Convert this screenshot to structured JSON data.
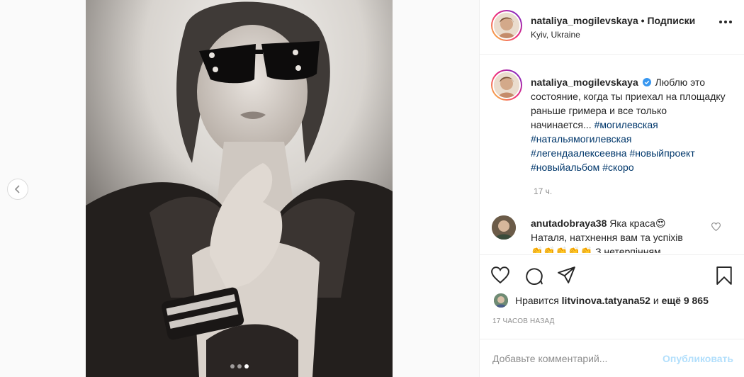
{
  "post": {
    "username": "nataliya_mogilevskaya",
    "separator": "•",
    "follow_label": "Подписки",
    "location": "Kyiv, Ukraine"
  },
  "caption": {
    "username": "nataliya_mogilevskaya",
    "text": "Люблю это состояние, когда ты приехал на площадку раньше гримера и все только начинается...",
    "hashtags": [
      "#могилевская",
      "#натальямогилевская",
      "#легендаалексеевна",
      "#новыйпроект",
      "#новыйальбом",
      "#скоро"
    ],
    "time": "17 ч."
  },
  "comment": {
    "username": "anutadobraya38",
    "text": "Яка краса",
    "emoji": "😍",
    "text2": "Наталя, натхнення вам та успіхів",
    "text3_emoji": "👏👏👏👏👏",
    "text3": "З нетерпінням"
  },
  "likes": {
    "prefix": "Нравится",
    "user": "litvinova.tatyana52",
    "and": "и",
    "count": "ещё 9 865"
  },
  "posted_ago": "17 ЧАСОВ НАЗАД",
  "add_comment": {
    "placeholder": "Добавьте комментарий...",
    "publish": "Опубликовать"
  },
  "carousel": {
    "slides": 3,
    "active": 3
  },
  "colors": {
    "link": "#00376b",
    "muted": "#8e8e8e",
    "verified": "#3897f0",
    "publish_disabled": "#b2dffc"
  }
}
